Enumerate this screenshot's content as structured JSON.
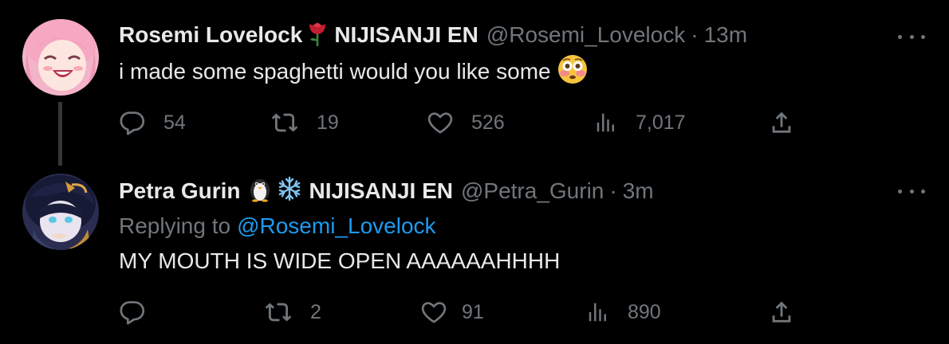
{
  "thread": [
    {
      "author": {
        "display_name": "Rosemi Lovelock",
        "name_emoji": "rose-icon",
        "affiliation": "NIJISANJI EN",
        "handle": "@Rosemi_Lovelock",
        "separator": "·",
        "time": "13m",
        "avatar_colors": {
          "hair": "#f6a7c1",
          "skin": "#fde6e0"
        }
      },
      "text": "i made some spaghetti would you like some",
      "text_emoji": "flushed-face-icon",
      "stats": {
        "replies": "54",
        "retweets": "19",
        "likes": "526",
        "views": "7,017"
      }
    },
    {
      "author": {
        "display_name": "Petra Gurin",
        "name_emojis": [
          "penguin-icon",
          "snowflake-icon"
        ],
        "affiliation": "NIJISANJI EN",
        "handle": "@Petra_Gurin",
        "separator": "·",
        "time": "3m",
        "avatar_colors": {
          "hair": "#1a1d3a",
          "accent": "#5bc7e8"
        }
      },
      "replying_to_label": "Replying to",
      "replying_to_handle": "@Rosemi_Lovelock",
      "text": "MY MOUTH IS WIDE OPEN AAAAAAHHHH",
      "stats": {
        "replies": "",
        "retweets": "2",
        "likes": "91",
        "views": "890"
      }
    }
  ],
  "colors": {
    "background": "#000000",
    "primary_text": "#e7e9ea",
    "secondary_text": "#71767b",
    "link": "#1d9bf0",
    "thread_line": "#333639"
  }
}
